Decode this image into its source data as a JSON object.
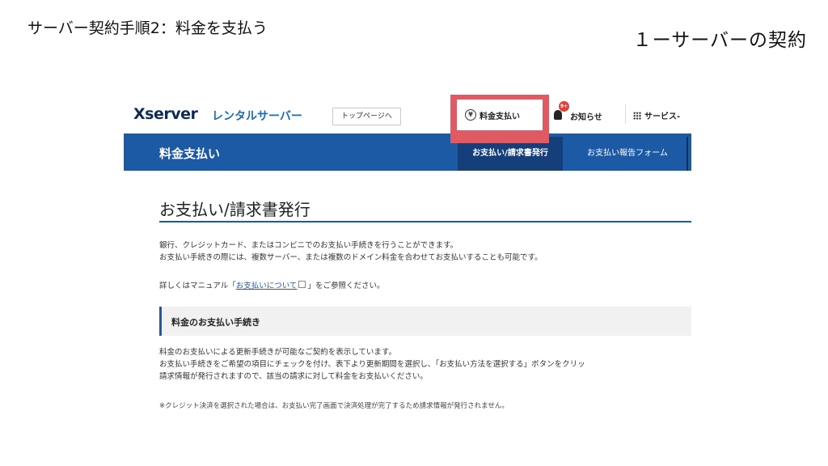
{
  "slide": {
    "title": "サーバー契約手順2：料金を支払う",
    "subtitle": "１ーサーバーの契約"
  },
  "header": {
    "logo": "Xserver",
    "logo_sub": "レンタルサーバー",
    "top_link": "トップページへ",
    "pay_button": "料金支払い",
    "pay_icon": "¥",
    "notice_badge": "9+",
    "notice_label": "お知らせ",
    "services_label": "サービス-"
  },
  "nav": {
    "section_title": "料金支払い",
    "tabs": [
      {
        "label": "お支払い/請求書発行",
        "active": true
      },
      {
        "label": "お支払い報告フォーム",
        "active": false
      }
    ]
  },
  "content": {
    "page_heading": "お支払い/請求書発行",
    "intro_line1": "銀行、クレジットカード、またはコンビニでのお支払い手続きを行うことができます。",
    "intro_line2": "お支払い手続きの際には、複数サーバー、または複数のドメイン料金を合わせてお支払いすることも可能です。",
    "manual_prefix": "詳しくはマニュアル「",
    "manual_link": "お支払いについて",
    "manual_suffix": "」をご参照ください。",
    "section_heading": "料金のお支払い手続き",
    "body_line1": "料金のお支払いによる更新手続きが可能なご契約を表示しています。",
    "body_line2": "お支払い手続きをご希望の項目にチェックを付け、表下より更新期間を選択し、「お支払い方法を選択する」ボタンをクリッ",
    "body_line3": "請求情報が発行されますので、該当の請求に対して料金をお支払いください。",
    "note": "※クレジット決済を選択された場合は、お支払い完了画面で決済処理が完了するため請求情報が発行されません。"
  },
  "colors": {
    "highlight": "#e05a63",
    "nav_blue": "#1d5aa6",
    "nav_active": "#153f7a",
    "logo": "#0f2a5a"
  }
}
